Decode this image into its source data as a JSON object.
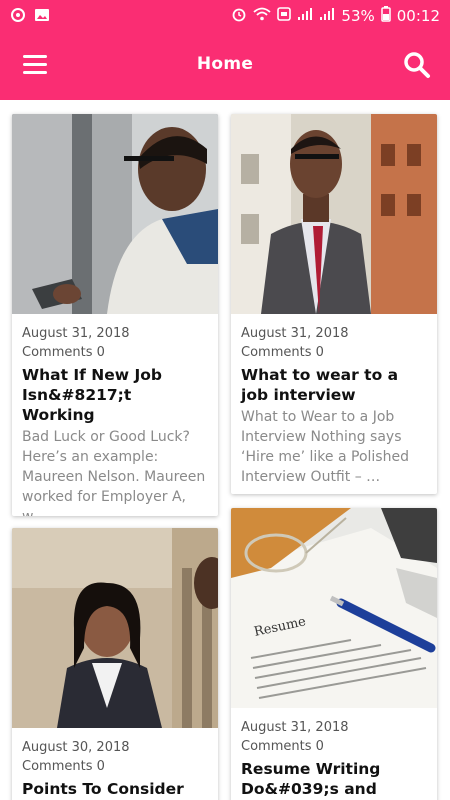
{
  "status": {
    "battery": "53%",
    "time": "00:12"
  },
  "header": {
    "title": "Home"
  },
  "posts": [
    {
      "date": "August 31, 2018",
      "comments": "Comments 0",
      "title": "What If New Job Isn&#8217;t Working",
      "excerpt": "Bad Luck or Good Luck? Here’s an example: Maureen Nelson. Maureen worked for Employer A, w…"
    },
    {
      "date": "August 31, 2018",
      "comments": "Comments 0",
      "title": "What to wear to a job interview",
      "excerpt": "What to Wear to a Job Interview Nothing says ‘Hire me’ like a Polished Interview Outfit – …"
    },
    {
      "date": "August 30, 2018",
      "comments": "Comments 0",
      "title": "Points To Consider",
      "excerpt": ""
    },
    {
      "date": "August 31, 2018",
      "comments": "Comments 0",
      "title": "Resume Writing Do&#039;s and",
      "excerpt": ""
    }
  ],
  "colors": {
    "accent": "#fa2d73"
  }
}
